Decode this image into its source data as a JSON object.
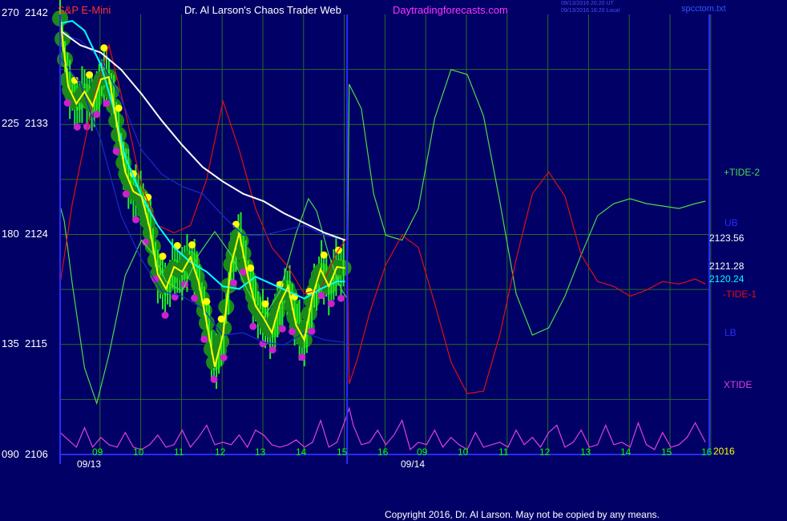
{
  "header": {
    "symbol": "S&P E-Mini",
    "title": "Dr. Al Larson's Chaos Trader Web",
    "site": "Daytradingforecasts.com",
    "timestamp1": "09/13/2016 20:20 UT",
    "timestamp2": "09/13/2016 16:20 Local",
    "file": "spcctom.txt"
  },
  "year_label": "2016",
  "copyright": "Copyright 2016, Dr. Al Larson. May not be copied by any means.",
  "colors": {
    "background": "#000066",
    "grid": "#2a6a2a",
    "frame": "#2a2aff",
    "price_ma_yellow": "#ffff00",
    "cyan_ma": "#00ffff",
    "white_ma": "#ffffff",
    "tide_plus": "#4cd94c",
    "tide_minus": "#e01010",
    "xtide": "#e040e0",
    "band": "#1a2ad0"
  },
  "chart_data": {
    "type": "line",
    "title": "S&P E-Mini",
    "y_axis_left_labels": [
      {
        "osc": "270",
        "price": "2142"
      },
      {
        "osc": "225",
        "price": "2133"
      },
      {
        "osc": "180",
        "price": "2124"
      },
      {
        "osc": "135",
        "price": "2115"
      },
      {
        "osc": "090",
        "price": "2106"
      }
    ],
    "price_ylim": [
      2106,
      2142
    ],
    "x_tick_labels": [
      "09",
      "10",
      "11",
      "12",
      "13",
      "14",
      "15",
      "16",
      "09",
      "10",
      "11",
      "12",
      "13",
      "14",
      "15",
      "16"
    ],
    "date_labels": [
      "09/13",
      "09/14"
    ],
    "right_labels": [
      {
        "text": "+TIDE-2",
        "color": "#4cd94c"
      },
      {
        "text": "UB",
        "color": "#2a2aff"
      },
      {
        "text": "2123.56",
        "color": "#ffffff"
      },
      {
        "text": "2121.28",
        "color": "#ffffff"
      },
      {
        "text": "2120.24",
        "color": "#00ffff"
      },
      {
        "text": "-TIDE-1",
        "color": "#e01010"
      },
      {
        "text": "LB",
        "color": "#2a2aff"
      },
      {
        "text": "XTIDE",
        "color": "#e040e0"
      }
    ],
    "series": [
      {
        "name": "+TIDE-2",
        "color": "#4cd94c",
        "x": [
          0,
          0.1,
          0.3,
          0.6,
          0.9,
          1.2,
          1.6,
          2.0,
          2.3,
          2.6,
          3.0,
          3.4,
          3.8,
          4.2,
          4.6,
          5.0,
          5.4,
          5.8,
          6.1,
          6.3,
          6.6,
          6.9,
          7.05,
          7.1,
          7.4,
          7.7,
          8.0,
          8.4,
          8.8,
          9.2,
          9.6,
          10.0,
          10.4,
          10.8,
          11.2,
          11.6,
          12.0,
          12.4,
          12.8,
          13.2,
          13.6,
          14.0,
          14.4,
          14.8,
          15.2,
          15.6,
          15.85
        ],
        "values": [
          2126.4,
          2125.2,
          2120.0,
          2113.1,
          2110.2,
          2114.2,
          2120.7,
          2123.6,
          2122.4,
          2120.2,
          2119.4,
          2122.4,
          2124.3,
          2122.4,
          2119.5,
          2117.2,
          2119.4,
          2124.2,
          2127.0,
          2126.0,
          2122.4,
          2119.6,
          2118.8,
          2136.4,
          2134.4,
          2127.4,
          2124.0,
          2123.6,
          2126.2,
          2133.6,
          2137.6,
          2137.2,
          2133.8,
          2126.8,
          2119.2,
          2115.8,
          2116.4,
          2119.0,
          2122.4,
          2125.6,
          2126.6,
          2127.0,
          2126.6,
          2126.4,
          2126.2,
          2126.6,
          2126.8
        ]
      },
      {
        "name": "-TIDE-1",
        "color": "#e01010",
        "x": [
          0,
          0.3,
          0.8,
          1.2,
          1.6,
          2.0,
          2.4,
          2.8,
          3.2,
          3.6,
          4.0,
          4.4,
          4.8,
          5.2,
          5.6,
          6.0,
          6.4,
          6.8,
          7.05,
          7.1,
          7.3,
          7.6,
          8.0,
          8.4,
          8.8,
          9.2,
          9.6,
          10.0,
          10.4,
          10.8,
          11.2,
          11.6,
          12.0,
          12.4,
          12.8,
          13.2,
          13.6,
          14.0,
          14.4,
          14.8,
          15.2,
          15.6,
          15.85
        ],
        "values": [
          2120.0,
          2126.6,
          2134.8,
          2139.6,
          2134.2,
          2128.0,
          2124.8,
          2124.2,
          2124.8,
          2128.6,
          2135.0,
          2131.0,
          2126.2,
          2123.0,
          2121.4,
          2119.2,
          2119.6,
          2122.6,
          2123.8,
          2111.8,
          2113.8,
          2117.6,
          2121.6,
          2124.0,
          2123.0,
          2118.4,
          2113.6,
          2111.0,
          2111.2,
          2115.8,
          2122.0,
          2127.4,
          2129.2,
          2127.2,
          2122.4,
          2120.2,
          2119.8,
          2119.0,
          2119.5,
          2120.2,
          2120.0,
          2120.4,
          2120.0
        ]
      },
      {
        "name": "UB",
        "color": "#1a2ad0",
        "x": [
          0,
          0.5,
          1.0,
          1.5,
          2.0,
          2.5,
          3.0,
          3.5,
          4.0,
          4.5,
          5.0,
          5.5,
          6.0,
          6.5,
          7.0
        ],
        "values": [
          2140.6,
          2140.0,
          2138.4,
          2135.2,
          2131.0,
          2129.0,
          2128.0,
          2127.4,
          2125.6,
          2124.0,
          2124.0,
          2124.4,
          2124.8,
          2124.0,
          2123.6
        ]
      },
      {
        "name": "LB",
        "color": "#1a2ad0",
        "x": [
          0,
          0.5,
          1.0,
          1.5,
          2.0,
          2.5,
          3.0,
          3.5,
          4.0,
          4.5,
          5.0,
          5.5,
          6.0,
          6.5,
          7.0
        ],
        "values": [
          2138.6,
          2136.4,
          2131.8,
          2125.6,
          2122.0,
          2119.4,
          2119.0,
          2118.0,
          2115.8,
          2116.0,
          2115.2,
          2115.0,
          2116.0,
          2115.4,
          2115.2
        ]
      },
      {
        "name": "2123.56",
        "color": "#ffffff",
        "x": [
          0,
          0.5,
          1.0,
          1.5,
          2.0,
          2.5,
          3.0,
          3.5,
          4.0,
          4.5,
          5.0,
          5.5,
          6.0,
          6.5,
          7.0
        ],
        "values": [
          2140.8,
          2139.6,
          2139.0,
          2137.6,
          2135.6,
          2133.4,
          2131.4,
          2129.6,
          2128.4,
          2127.4,
          2126.8,
          2125.8,
          2125.0,
          2124.2,
          2123.6
        ]
      },
      {
        "name": "2120.24",
        "color": "#00ffff",
        "x": [
          0,
          0.3,
          0.6,
          1.0,
          1.3,
          1.6,
          2.0,
          2.4,
          2.8,
          3.2,
          3.6,
          4.0,
          4.4,
          4.8,
          5.2,
          5.6,
          6.0,
          6.4,
          6.8,
          7.0
        ],
        "values": [
          2141.4,
          2141.6,
          2140.8,
          2138.0,
          2134.6,
          2130.4,
          2127.2,
          2124.8,
          2123.0,
          2121.8,
          2121.0,
          2119.8,
          2119.6,
          2120.6,
          2120.0,
          2119.4,
          2118.8,
          2119.6,
          2120.2,
          2120.2
        ]
      },
      {
        "name": "2121.28",
        "color": "#ffff00",
        "x": [
          0,
          0.2,
          0.4,
          0.6,
          0.8,
          1.0,
          1.2,
          1.4,
          1.6,
          1.8,
          2.0,
          2.2,
          2.4,
          2.6,
          2.8,
          3.0,
          3.2,
          3.4,
          3.6,
          3.8,
          4.0,
          4.2,
          4.4,
          4.6,
          4.8,
          5.0,
          5.2,
          5.4,
          5.6,
          5.8,
          6.0,
          6.2,
          6.4,
          6.6,
          6.8,
          7.0
        ],
        "values": [
          2141.8,
          2136.2,
          2134.8,
          2135.8,
          2134.6,
          2136.8,
          2137.0,
          2133.0,
          2129.2,
          2127.6,
          2127.2,
          2124.6,
          2120.8,
          2119.6,
          2121.4,
          2121.0,
          2122.2,
          2120.2,
          2116.8,
          2113.2,
          2115.8,
          2121.6,
          2124.2,
          2120.8,
          2118.2,
          2117.2,
          2116.0,
          2118.4,
          2119.8,
          2116.6,
          2115.4,
          2119.0,
          2121.2,
          2119.8,
          2121.4,
          2121.3
        ]
      },
      {
        "name": "XTIDE",
        "color": "#e040e0",
        "x": [
          0,
          0.2,
          0.4,
          0.6,
          0.8,
          1.0,
          1.2,
          1.4,
          1.6,
          1.8,
          2.0,
          2.2,
          2.4,
          2.6,
          2.8,
          3.0,
          3.2,
          3.4,
          3.6,
          3.8,
          4.0,
          4.2,
          4.4,
          4.6,
          4.8,
          5.0,
          5.2,
          5.4,
          5.6,
          5.8,
          6.0,
          6.2,
          6.4,
          6.6,
          6.8,
          7.0,
          7.1,
          7.2,
          7.4,
          7.6,
          7.8,
          8.0,
          8.2,
          8.4,
          8.6,
          8.8,
          9.0,
          9.2,
          9.4,
          9.6,
          9.8,
          10.0,
          10.2,
          10.4,
          10.6,
          10.8,
          11.0,
          11.2,
          11.4,
          11.6,
          11.8,
          12.0,
          12.2,
          12.4,
          12.6,
          12.8,
          13.0,
          13.2,
          13.4,
          13.6,
          13.8,
          14.0,
          14.2,
          14.4,
          14.6,
          14.8,
          15.0,
          15.2,
          15.4,
          15.6,
          15.85
        ],
        "values": [
          2107.8,
          2107.2,
          2106.6,
          2108.2,
          2106.6,
          2107.4,
          2106.8,
          2106.6,
          2107.8,
          2106.6,
          2106.4,
          2106.8,
          2107.6,
          2106.6,
          2106.8,
          2108.0,
          2106.6,
          2107.4,
          2108.4,
          2106.8,
          2107.0,
          2106.8,
          2107.6,
          2106.6,
          2108.0,
          2107.6,
          2106.8,
          2106.6,
          2106.8,
          2107.2,
          2106.6,
          2107.0,
          2108.8,
          2106.6,
          2107.0,
          2108.8,
          2109.8,
          2108.4,
          2106.8,
          2107.0,
          2108.0,
          2106.8,
          2107.6,
          2108.8,
          2106.4,
          2107.0,
          2106.8,
          2108.0,
          2106.6,
          2107.4,
          2106.8,
          2106.4,
          2107.8,
          2106.6,
          2106.8,
          2107.0,
          2106.6,
          2108.0,
          2106.8,
          2107.4,
          2106.6,
          2107.8,
          2108.4,
          2106.6,
          2107.0,
          2108.0,
          2106.6,
          2106.8,
          2108.4,
          2106.8,
          2107.0,
          2106.6,
          2108.6,
          2106.8,
          2106.4,
          2107.8,
          2106.6,
          2106.8,
          2107.4,
          2108.6,
          2107.0
        ]
      }
    ]
  }
}
